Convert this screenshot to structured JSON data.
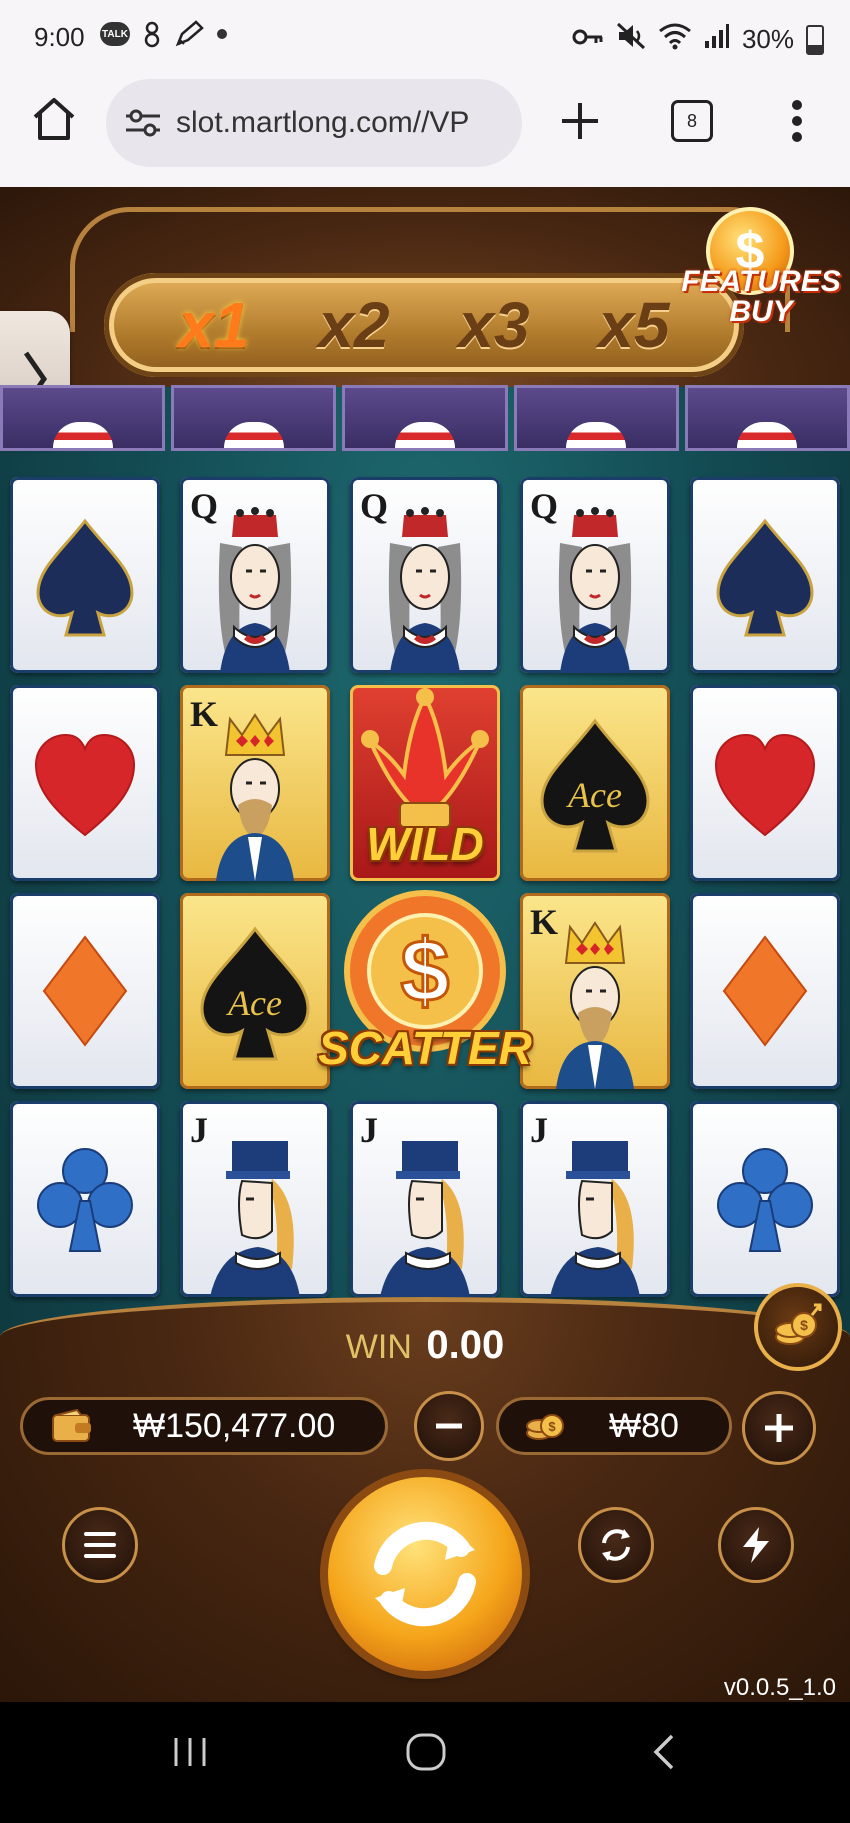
{
  "status_bar": {
    "time": "9:00",
    "left_icons": [
      "talk-icon",
      "usb-icon",
      "pen-icon",
      "dot-icon"
    ],
    "talk_label": "TALK",
    "right_icons": [
      "key-icon",
      "mute-icon",
      "wifi-icon",
      "signal-icon",
      "battery-icon"
    ],
    "battery": "30%"
  },
  "browser": {
    "url": "slot.martlong.com//VP",
    "tab_count": "8"
  },
  "game": {
    "multipliers": [
      {
        "label": "x1",
        "active": true
      },
      {
        "label": "x2",
        "active": false
      },
      {
        "label": "x3",
        "active": false
      },
      {
        "label": "x5",
        "active": false
      }
    ],
    "features_buy": {
      "line1": "FEATURES",
      "line2": "BUY"
    },
    "reels": [
      [
        "spade",
        "heart",
        "diamond",
        "club"
      ],
      [
        "queen",
        "king",
        "ace",
        "jack"
      ],
      [
        "queen",
        "wild",
        "scatter",
        "jack"
      ],
      [
        "queen",
        "ace",
        "king",
        "jack"
      ],
      [
        "spade",
        "heart",
        "diamond",
        "club"
      ]
    ],
    "card_letters": {
      "queen": "Q",
      "king": "K",
      "jack": "J"
    },
    "ace_label": "Ace",
    "wild_label": "WILD",
    "scatter_label": "SCATTER",
    "win_label": "WIN",
    "win_value": "0.00",
    "balance": "₩150,477.00",
    "bet": "₩80",
    "version": "v0.0.5_1.0",
    "colors": {
      "accent": "#f5a51a",
      "table": "#134a52",
      "frame": "#4a2812"
    }
  }
}
